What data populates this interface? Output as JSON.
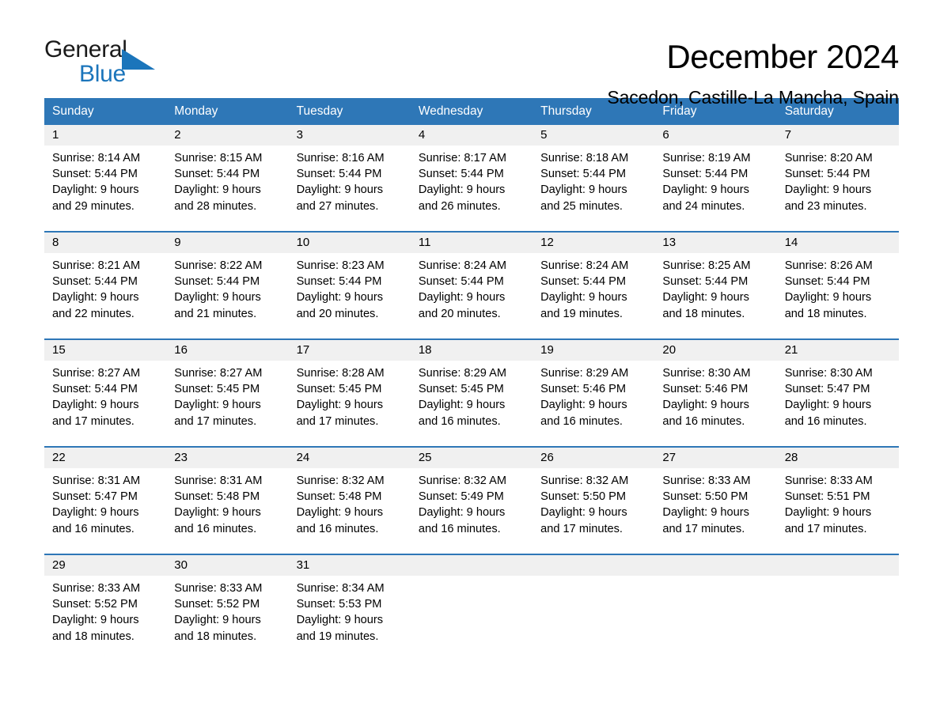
{
  "brand": {
    "name_part1": "General",
    "name_part2": "Blue",
    "accent_color": "#1b75bb"
  },
  "header": {
    "title": "December 2024",
    "location": "Sacedon, Castille-La Mancha, Spain"
  },
  "calendar": {
    "header_color": "#2e77b7",
    "weekdays": [
      "Sunday",
      "Monday",
      "Tuesday",
      "Wednesday",
      "Thursday",
      "Friday",
      "Saturday"
    ],
    "weeks": [
      {
        "days": [
          {
            "date": "1",
            "sunrise": "Sunrise: 8:14 AM",
            "sunset": "Sunset: 5:44 PM",
            "daylight_line1": "Daylight: 9 hours",
            "daylight_line2": "and 29 minutes."
          },
          {
            "date": "2",
            "sunrise": "Sunrise: 8:15 AM",
            "sunset": "Sunset: 5:44 PM",
            "daylight_line1": "Daylight: 9 hours",
            "daylight_line2": "and 28 minutes."
          },
          {
            "date": "3",
            "sunrise": "Sunrise: 8:16 AM",
            "sunset": "Sunset: 5:44 PM",
            "daylight_line1": "Daylight: 9 hours",
            "daylight_line2": "and 27 minutes."
          },
          {
            "date": "4",
            "sunrise": "Sunrise: 8:17 AM",
            "sunset": "Sunset: 5:44 PM",
            "daylight_line1": "Daylight: 9 hours",
            "daylight_line2": "and 26 minutes."
          },
          {
            "date": "5",
            "sunrise": "Sunrise: 8:18 AM",
            "sunset": "Sunset: 5:44 PM",
            "daylight_line1": "Daylight: 9 hours",
            "daylight_line2": "and 25 minutes."
          },
          {
            "date": "6",
            "sunrise": "Sunrise: 8:19 AM",
            "sunset": "Sunset: 5:44 PM",
            "daylight_line1": "Daylight: 9 hours",
            "daylight_line2": "and 24 minutes."
          },
          {
            "date": "7",
            "sunrise": "Sunrise: 8:20 AM",
            "sunset": "Sunset: 5:44 PM",
            "daylight_line1": "Daylight: 9 hours",
            "daylight_line2": "and 23 minutes."
          }
        ]
      },
      {
        "days": [
          {
            "date": "8",
            "sunrise": "Sunrise: 8:21 AM",
            "sunset": "Sunset: 5:44 PM",
            "daylight_line1": "Daylight: 9 hours",
            "daylight_line2": "and 22 minutes."
          },
          {
            "date": "9",
            "sunrise": "Sunrise: 8:22 AM",
            "sunset": "Sunset: 5:44 PM",
            "daylight_line1": "Daylight: 9 hours",
            "daylight_line2": "and 21 minutes."
          },
          {
            "date": "10",
            "sunrise": "Sunrise: 8:23 AM",
            "sunset": "Sunset: 5:44 PM",
            "daylight_line1": "Daylight: 9 hours",
            "daylight_line2": "and 20 minutes."
          },
          {
            "date": "11",
            "sunrise": "Sunrise: 8:24 AM",
            "sunset": "Sunset: 5:44 PM",
            "daylight_line1": "Daylight: 9 hours",
            "daylight_line2": "and 20 minutes."
          },
          {
            "date": "12",
            "sunrise": "Sunrise: 8:24 AM",
            "sunset": "Sunset: 5:44 PM",
            "daylight_line1": "Daylight: 9 hours",
            "daylight_line2": "and 19 minutes."
          },
          {
            "date": "13",
            "sunrise": "Sunrise: 8:25 AM",
            "sunset": "Sunset: 5:44 PM",
            "daylight_line1": "Daylight: 9 hours",
            "daylight_line2": "and 18 minutes."
          },
          {
            "date": "14",
            "sunrise": "Sunrise: 8:26 AM",
            "sunset": "Sunset: 5:44 PM",
            "daylight_line1": "Daylight: 9 hours",
            "daylight_line2": "and 18 minutes."
          }
        ]
      },
      {
        "days": [
          {
            "date": "15",
            "sunrise": "Sunrise: 8:27 AM",
            "sunset": "Sunset: 5:44 PM",
            "daylight_line1": "Daylight: 9 hours",
            "daylight_line2": "and 17 minutes."
          },
          {
            "date": "16",
            "sunrise": "Sunrise: 8:27 AM",
            "sunset": "Sunset: 5:45 PM",
            "daylight_line1": "Daylight: 9 hours",
            "daylight_line2": "and 17 minutes."
          },
          {
            "date": "17",
            "sunrise": "Sunrise: 8:28 AM",
            "sunset": "Sunset: 5:45 PM",
            "daylight_line1": "Daylight: 9 hours",
            "daylight_line2": "and 17 minutes."
          },
          {
            "date": "18",
            "sunrise": "Sunrise: 8:29 AM",
            "sunset": "Sunset: 5:45 PM",
            "daylight_line1": "Daylight: 9 hours",
            "daylight_line2": "and 16 minutes."
          },
          {
            "date": "19",
            "sunrise": "Sunrise: 8:29 AM",
            "sunset": "Sunset: 5:46 PM",
            "daylight_line1": "Daylight: 9 hours",
            "daylight_line2": "and 16 minutes."
          },
          {
            "date": "20",
            "sunrise": "Sunrise: 8:30 AM",
            "sunset": "Sunset: 5:46 PM",
            "daylight_line1": "Daylight: 9 hours",
            "daylight_line2": "and 16 minutes."
          },
          {
            "date": "21",
            "sunrise": "Sunrise: 8:30 AM",
            "sunset": "Sunset: 5:47 PM",
            "daylight_line1": "Daylight: 9 hours",
            "daylight_line2": "and 16 minutes."
          }
        ]
      },
      {
        "days": [
          {
            "date": "22",
            "sunrise": "Sunrise: 8:31 AM",
            "sunset": "Sunset: 5:47 PM",
            "daylight_line1": "Daylight: 9 hours",
            "daylight_line2": "and 16 minutes."
          },
          {
            "date": "23",
            "sunrise": "Sunrise: 8:31 AM",
            "sunset": "Sunset: 5:48 PM",
            "daylight_line1": "Daylight: 9 hours",
            "daylight_line2": "and 16 minutes."
          },
          {
            "date": "24",
            "sunrise": "Sunrise: 8:32 AM",
            "sunset": "Sunset: 5:48 PM",
            "daylight_line1": "Daylight: 9 hours",
            "daylight_line2": "and 16 minutes."
          },
          {
            "date": "25",
            "sunrise": "Sunrise: 8:32 AM",
            "sunset": "Sunset: 5:49 PM",
            "daylight_line1": "Daylight: 9 hours",
            "daylight_line2": "and 16 minutes."
          },
          {
            "date": "26",
            "sunrise": "Sunrise: 8:32 AM",
            "sunset": "Sunset: 5:50 PM",
            "daylight_line1": "Daylight: 9 hours",
            "daylight_line2": "and 17 minutes."
          },
          {
            "date": "27",
            "sunrise": "Sunrise: 8:33 AM",
            "sunset": "Sunset: 5:50 PM",
            "daylight_line1": "Daylight: 9 hours",
            "daylight_line2": "and 17 minutes."
          },
          {
            "date": "28",
            "sunrise": "Sunrise: 8:33 AM",
            "sunset": "Sunset: 5:51 PM",
            "daylight_line1": "Daylight: 9 hours",
            "daylight_line2": "and 17 minutes."
          }
        ]
      },
      {
        "days": [
          {
            "date": "29",
            "sunrise": "Sunrise: 8:33 AM",
            "sunset": "Sunset: 5:52 PM",
            "daylight_line1": "Daylight: 9 hours",
            "daylight_line2": "and 18 minutes."
          },
          {
            "date": "30",
            "sunrise": "Sunrise: 8:33 AM",
            "sunset": "Sunset: 5:52 PM",
            "daylight_line1": "Daylight: 9 hours",
            "daylight_line2": "and 18 minutes."
          },
          {
            "date": "31",
            "sunrise": "Sunrise: 8:34 AM",
            "sunset": "Sunset: 5:53 PM",
            "daylight_line1": "Daylight: 9 hours",
            "daylight_line2": "and 19 minutes."
          },
          {
            "date": "",
            "sunrise": "",
            "sunset": "",
            "daylight_line1": "",
            "daylight_line2": ""
          },
          {
            "date": "",
            "sunrise": "",
            "sunset": "",
            "daylight_line1": "",
            "daylight_line2": ""
          },
          {
            "date": "",
            "sunrise": "",
            "sunset": "",
            "daylight_line1": "",
            "daylight_line2": ""
          },
          {
            "date": "",
            "sunrise": "",
            "sunset": "",
            "daylight_line1": "",
            "daylight_line2": ""
          }
        ]
      }
    ]
  }
}
